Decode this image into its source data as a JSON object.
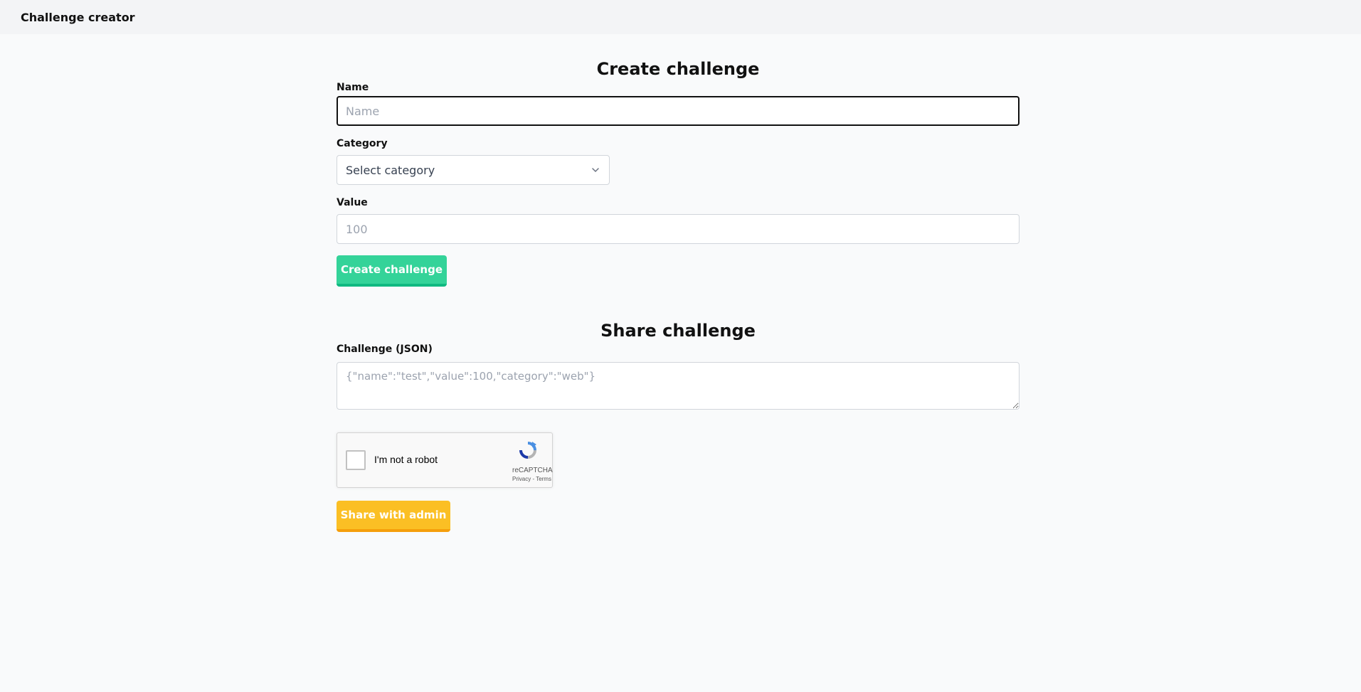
{
  "header": {
    "title": "Challenge creator"
  },
  "create": {
    "title": "Create challenge",
    "name_label": "Name",
    "name_placeholder": "Name",
    "category_label": "Category",
    "category_selected": "Select category",
    "value_label": "Value",
    "value_placeholder": "100",
    "submit_label": "Create challenge"
  },
  "share": {
    "title": "Share challenge",
    "json_label": "Challenge (JSON)",
    "json_placeholder": "{\"name\":\"test\",\"value\":100,\"category\":\"web\"}",
    "captcha": {
      "label": "I'm not a robot",
      "brand": "reCAPTCHA",
      "links": "Privacy - Terms"
    },
    "submit_label": "Share with admin"
  },
  "colors": {
    "green": "#34d399",
    "yellow": "#fbbf24",
    "background": "#f9fafb",
    "header": "#f3f4f6"
  }
}
